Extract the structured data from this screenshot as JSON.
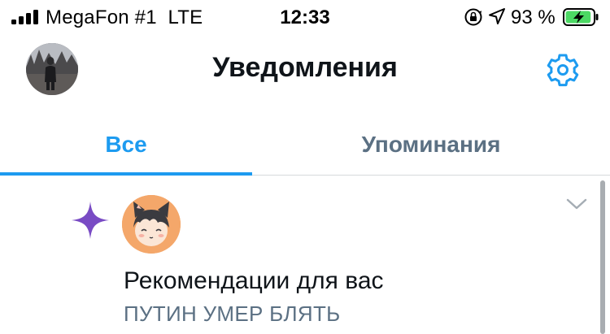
{
  "status_bar": {
    "carrier": "MegaFon #1",
    "network": "LTE",
    "time": "12:33",
    "battery_percent": "93 %",
    "battery_level": 0.93,
    "charging_color": "#4cd964"
  },
  "header": {
    "title": "Уведомления",
    "avatar_icon": "profile-photo",
    "settings_icon": "gear-icon"
  },
  "tabs": [
    {
      "label": "Все",
      "active": true
    },
    {
      "label": "Упоминания",
      "active": false
    }
  ],
  "notification": {
    "icon": "sparkle-icon",
    "title": "Рекомендации для вас",
    "subtitle": "ПУТИН УМЕР БЛЯТЬ"
  },
  "colors": {
    "accent": "#1d9bf0",
    "secondary_text": "#5b7083",
    "sparkle": "#794bc4"
  }
}
